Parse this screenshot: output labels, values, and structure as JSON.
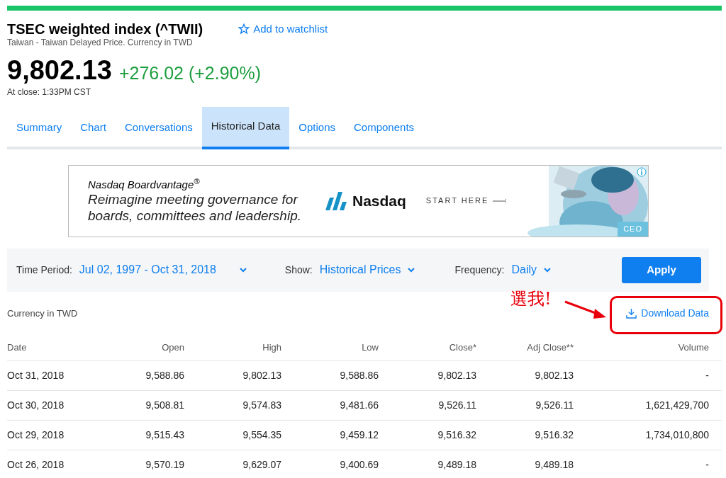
{
  "header": {
    "title": "TSEC weighted index (^TWII)",
    "watchlist": "Add to watchlist",
    "subtitle": "Taiwan - Taiwan Delayed Price. Currency in TWD"
  },
  "quote": {
    "price": "9,802.13",
    "change": "+276.02 (+2.90%)",
    "time": "At close: 1:33PM CST"
  },
  "tabs": [
    {
      "label": "Summary",
      "selected": false
    },
    {
      "label": "Chart",
      "selected": false
    },
    {
      "label": "Conversations",
      "selected": false
    },
    {
      "label": "Historical Data",
      "selected": true
    },
    {
      "label": "Options",
      "selected": false
    },
    {
      "label": "Components",
      "selected": false
    }
  ],
  "ad": {
    "brand_line": "Nasdaq Boardvantage$^{®}$",
    "headline": "Reimagine meeting governance for boards, committees and leadership.",
    "logo": "Nasdaq",
    "cta": "START HERE",
    "tag": "CEO"
  },
  "filters": {
    "time_period": {
      "label": "Time Period:",
      "value": "Jul 02, 1997 - Oct 31, 2018"
    },
    "show": {
      "label": "Show:",
      "value": "Historical Prices"
    },
    "frequency": {
      "label": "Frequency:",
      "value": "Daily"
    },
    "apply": "Apply"
  },
  "currency_note": "Currency in TWD",
  "download": "Download Data",
  "annotation": {
    "text": "選我!",
    "color": "#e8000b"
  },
  "table": {
    "columns": [
      "Date",
      "Open",
      "High",
      "Low",
      "Close*",
      "Adj Close**",
      "Volume"
    ],
    "rows": [
      [
        "Oct 31, 2018",
        "9,588.86",
        "9,802.13",
        "9,588.86",
        "9,802.13",
        "9,802.13",
        "-"
      ],
      [
        "Oct 30, 2018",
        "9,508.81",
        "9,574.83",
        "9,481.66",
        "9,526.11",
        "9,526.11",
        "1,621,429,700"
      ],
      [
        "Oct 29, 2018",
        "9,515.43",
        "9,554.35",
        "9,459.12",
        "9,516.32",
        "9,516.32",
        "1,734,010,800"
      ],
      [
        "Oct 26, 2018",
        "9,570.19",
        "9,629.07",
        "9,400.69",
        "9,489.18",
        "9,489.18",
        "-"
      ]
    ]
  }
}
